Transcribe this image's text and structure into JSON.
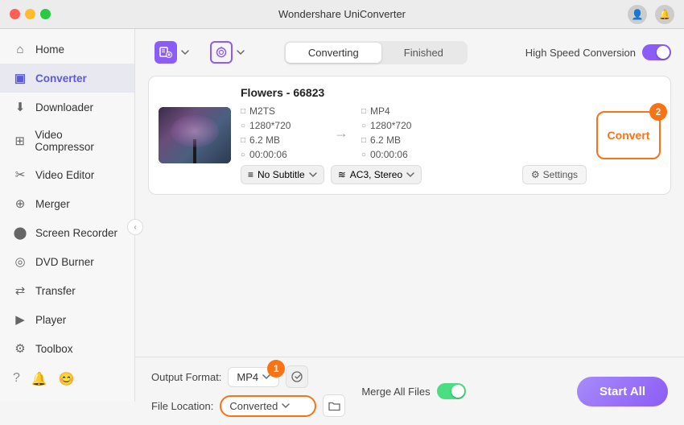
{
  "titlebar": {
    "title": "Wondershare UniConverter",
    "user_icon": "👤",
    "bell_icon": "🔔"
  },
  "sidebar": {
    "items": [
      {
        "id": "home",
        "label": "Home",
        "icon": "⌂"
      },
      {
        "id": "converter",
        "label": "Converter",
        "icon": "▣",
        "active": true
      },
      {
        "id": "downloader",
        "label": "Downloader",
        "icon": "⬇"
      },
      {
        "id": "video-compressor",
        "label": "Video Compressor",
        "icon": "⊞"
      },
      {
        "id": "video-editor",
        "label": "Video Editor",
        "icon": "✂"
      },
      {
        "id": "merger",
        "label": "Merger",
        "icon": "⊕"
      },
      {
        "id": "screen-recorder",
        "label": "Screen Recorder",
        "icon": "⬤"
      },
      {
        "id": "dvd-burner",
        "label": "DVD Burner",
        "icon": "◎"
      },
      {
        "id": "transfer",
        "label": "Transfer",
        "icon": "⇄"
      },
      {
        "id": "player",
        "label": "Player",
        "icon": "▶"
      },
      {
        "id": "toolbox",
        "label": "Toolbox",
        "icon": "⚙"
      }
    ],
    "bottom_icons": [
      "?",
      "🔔",
      "😊"
    ]
  },
  "toolbar": {
    "add_btn_label": "+",
    "scan_btn_label": "⟳",
    "converting_tab": "Converting",
    "finished_tab": "Finished",
    "speed_label": "High Speed Conversion"
  },
  "file_card": {
    "title": "Flowers - 66823",
    "source_format": "M2TS",
    "source_resolution": "1280*720",
    "source_size": "6.2 MB",
    "source_duration": "00:00:06",
    "target_format": "MP4",
    "target_resolution": "1280*720",
    "target_size": "6.2 MB",
    "target_duration": "00:00:06",
    "subtitle_label": "No Subtitle",
    "audio_label": "AC3, Stereo",
    "settings_label": "Settings",
    "convert_btn_label": "Convert",
    "convert_badge": "2"
  },
  "bottom_bar": {
    "output_format_label": "Output Format:",
    "output_format_value": "MP4",
    "format_badge": "1",
    "merge_files_label": "Merge All Files",
    "file_location_label": "File Location:",
    "file_location_value": "Converted",
    "start_all_label": "Start All"
  }
}
